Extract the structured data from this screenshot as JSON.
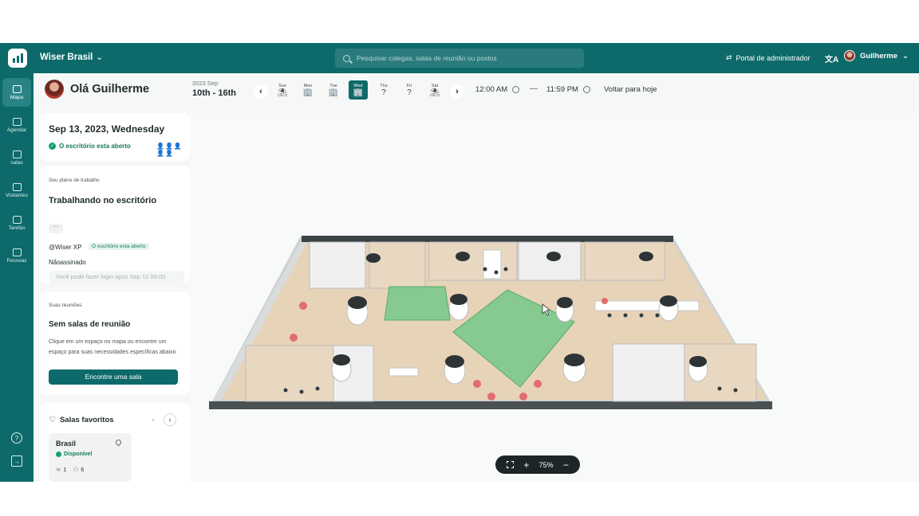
{
  "topbar": {
    "org_name": "Wiser Brasil",
    "search_placeholder": "Pesquisar colegas, salas de reunião ou postos",
    "admin_label": "Portal de administrador",
    "translate_icon": "translate-icon",
    "user_name": "Guilherme",
    "accent": "#0e6a6a"
  },
  "rail": {
    "items": [
      {
        "label": "Mapa",
        "icon": "home-icon"
      },
      {
        "label": "Agendar",
        "icon": "calendar-icon"
      },
      {
        "label": "salas",
        "icon": "room-icon"
      },
      {
        "label": "Visitantes",
        "icon": "visitor-icon"
      },
      {
        "label": "Tarefas",
        "icon": "tasks-icon"
      },
      {
        "label": "Pessoas",
        "icon": "people-icon"
      }
    ],
    "help_icon": "help-icon",
    "logout_icon": "logout-icon"
  },
  "header": {
    "greeting": "Olá Guilherme",
    "week_year": "2023 Sep",
    "week_range": "10th - 16th",
    "days": [
      {
        "name": "Sun",
        "icon": "beach-icon",
        "glyph": "⛱"
      },
      {
        "name": "Mon",
        "icon": "office-icon",
        "glyph": "🏢"
      },
      {
        "name": "Tue",
        "icon": "office-icon",
        "glyph": "🏢"
      },
      {
        "name": "Wed",
        "icon": "office-icon",
        "glyph": "🏢"
      },
      {
        "name": "Thu",
        "icon": "question-icon",
        "glyph": "?"
      },
      {
        "name": "Fri",
        "icon": "question-icon",
        "glyph": "?"
      },
      {
        "name": "Sat",
        "icon": "beach-icon",
        "glyph": "⛱"
      }
    ],
    "selected_day": "Wed",
    "time_start": "12:00 AM",
    "time_end": "11:59 PM",
    "today_label": "Voltar para hoje"
  },
  "status_card": {
    "date": "Sep 13, 2023, Wednesday",
    "office_status": "O escritório esta aberto",
    "people_indicator": "👤👤👤👤👤"
  },
  "work_plan": {
    "section_title": "Seu plano de trabalho",
    "plan": "Trabalhando no escritório",
    "more": "···",
    "office": "@Wiser XP",
    "office_tag": "O escritório esta aberto",
    "assignment": "Nãoassinado",
    "login_hint": "Você pode fazer login após Sep 12 00:00"
  },
  "meetings": {
    "section_title": "Suas reuniões",
    "empty_title": "Sem salas de reunião",
    "description": "Clique em um espaço no mapa ou encontre um espaço para suas necessidades específicas abaixo",
    "find_button": "Encontre uma sala"
  },
  "favorites": {
    "title": "Salas favoritos",
    "cards": [
      {
        "name": "Brasil",
        "status": "Disponível",
        "floors": "1",
        "capacity": "6"
      }
    ]
  },
  "map": {
    "zoom_level": "75%",
    "highlight_color": "#6fcf7f",
    "floor_color": "#e7d3b8"
  }
}
